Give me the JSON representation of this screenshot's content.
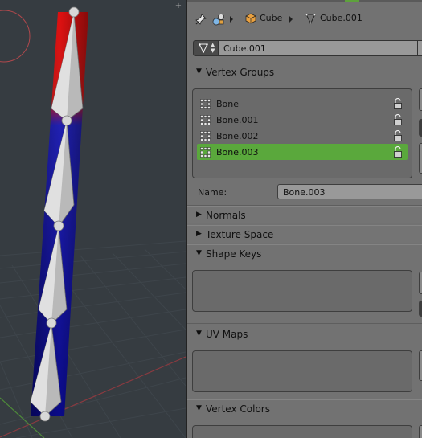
{
  "breadcrumb": {
    "object_name": "Cube",
    "mesh_name": "Cube.001"
  },
  "datablock": {
    "name": "Cube.001"
  },
  "panels": {
    "vertex_groups": "Vertex Groups",
    "normals": "Normals",
    "texture_space": "Texture Space",
    "shape_keys": "Shape Keys",
    "uv_maps": "UV Maps",
    "vertex_colors": "Vertex Colors"
  },
  "vertex_groups": {
    "items": [
      {
        "label": "Bone",
        "selected": false
      },
      {
        "label": "Bone.001",
        "selected": false
      },
      {
        "label": "Bone.002",
        "selected": false
      },
      {
        "label": "Bone.003",
        "selected": true
      }
    ],
    "name_label": "Name:",
    "name_value": "Bone.003"
  },
  "icons": {
    "pin": "pin-icon",
    "scene": "scene-icon",
    "object": "cube-icon",
    "mesh": "mesh-icon",
    "vertex_group": "vertex-group-icon",
    "lock": "lock-open-icon"
  },
  "colors": {
    "selection": "#5aa83c",
    "panel_bg": "#727272",
    "viewport_bg": "#363c41"
  }
}
